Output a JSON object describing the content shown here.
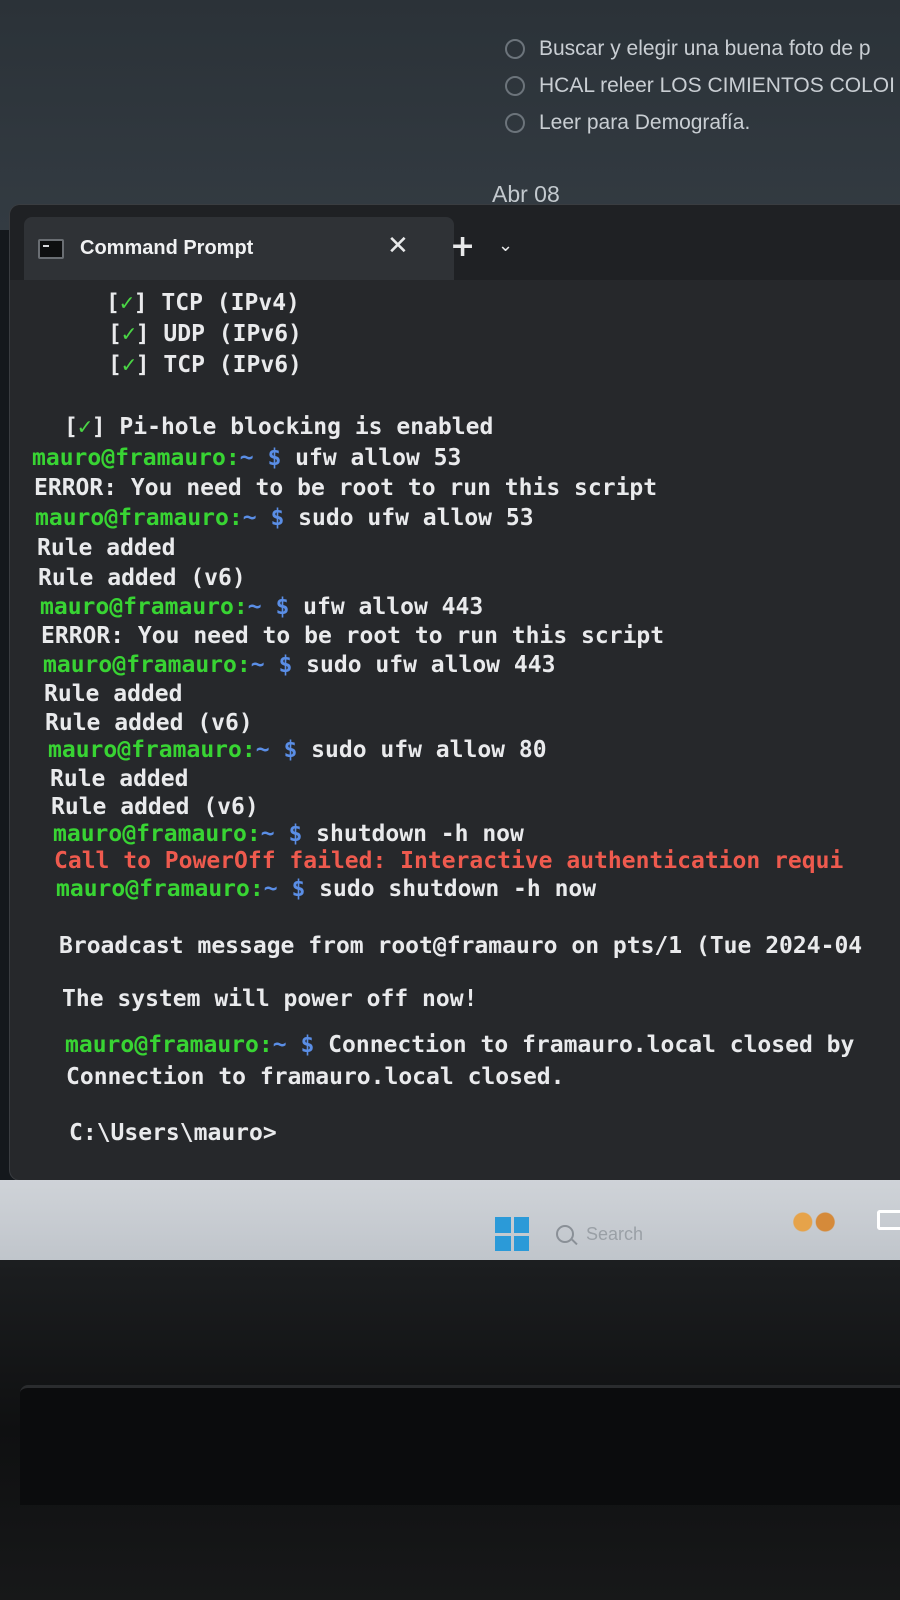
{
  "todo": {
    "items": [
      {
        "label": "Buscar y elegir una buena foto de p"
      },
      {
        "label": "HCAL releer LOS CIMIENTOS COLOI"
      },
      {
        "label": "Leer para Demografía."
      }
    ],
    "date_heading": "Abr 08"
  },
  "window": {
    "tab_title": "Command Prompt",
    "tab_close_icon": "close-icon",
    "new_tab_icon": "plus-icon",
    "dropdown_icon": "chevron-down-icon"
  },
  "console": {
    "check_lines": [
      {
        "mark": "✓",
        "text": "TCP (IPv4)"
      },
      {
        "mark": "✓",
        "text": "UDP (IPv6)"
      },
      {
        "mark": "✓",
        "text": "TCP (IPv6)"
      }
    ],
    "pihole": {
      "mark": "✓",
      "text": "Pi-hole blocking is enabled"
    },
    "prompt": {
      "user": "mauro@framauro",
      "sep": ":",
      "tilde": "~",
      "dollar": "$"
    },
    "cmd1": "ufw allow 53",
    "out1": "ERROR: You need to be root to run this script",
    "cmd2": "sudo ufw allow 53",
    "out2a": "Rule added",
    "out2b": "Rule added (v6)",
    "cmd3": "ufw allow 443",
    "out3": "ERROR: You need to be root to run this script",
    "cmd4": "sudo ufw allow 443",
    "out4a": "Rule added",
    "out4b": "Rule added (v6)",
    "cmd5": "sudo ufw allow 80",
    "out5a": "Rule added",
    "out5b": "Rule added (v6)",
    "cmd6": "shutdown -h now",
    "out6": "Call to PowerOff failed: Interactive authentication requi",
    "cmd7": "sudo shutdown -h now",
    "broadcast": "Broadcast message from root@framauro on pts/1 (Tue 2024-04",
    "poweroff": "The system will power off now!",
    "cmd8": "Connection to framauro.local closed by",
    "closed": "Connection to framauro.local closed.",
    "win_prompt": "C:\\Users\\mauro>"
  },
  "taskbar": {
    "start_icon": "windows-logo-icon",
    "search_placeholder": "Search",
    "widget_icon": "weather-widget-icon",
    "app_icon": "app-icon"
  },
  "colors": {
    "prompt_green": "#38d433",
    "prompt_blue": "#5a8ee6",
    "error_red": "#ee5a4e",
    "terminal_bg": "#26282b"
  }
}
